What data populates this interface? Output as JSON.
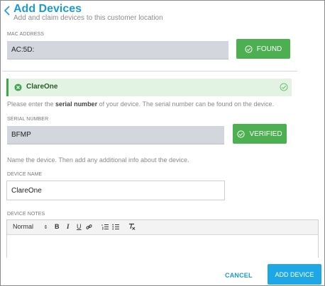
{
  "header": {
    "title": "Add Devices",
    "subtitle": "Add and claim devices to this customer location"
  },
  "mac": {
    "label": "MAC ADDRESS",
    "value": "AC:5D:",
    "button_label": "FOUND"
  },
  "found_device": {
    "name": "ClareOne"
  },
  "serial": {
    "instruction_before": "Please enter the ",
    "instruction_bold": "serial number",
    "instruction_after": " of your device. The serial number can be found on the device.",
    "label": "SERIAL NUMBER",
    "value": "BFMP",
    "button_label": "VERIFIED"
  },
  "name_section": {
    "instruction": "Name the device. Then add any additional info about the device.",
    "label": "DEVICE NAME",
    "value": "ClareOne"
  },
  "notes": {
    "label": "DEVICE NOTES",
    "toolbar": {
      "style_select": "Normal",
      "bold": "B",
      "italic": "I",
      "underline": "U"
    }
  },
  "footer": {
    "cancel_label": "CANCEL",
    "add_label": "ADD DEVICE"
  },
  "colors": {
    "accent": "#1a9ad6",
    "success": "#4caf50",
    "field_gray": "#d3d7dd"
  },
  "icons": [
    "chevron-left-icon",
    "check-circle-icon",
    "x-circle-icon",
    "link-icon",
    "ordered-list-icon",
    "bullet-list-icon",
    "clear-format-icon"
  ]
}
